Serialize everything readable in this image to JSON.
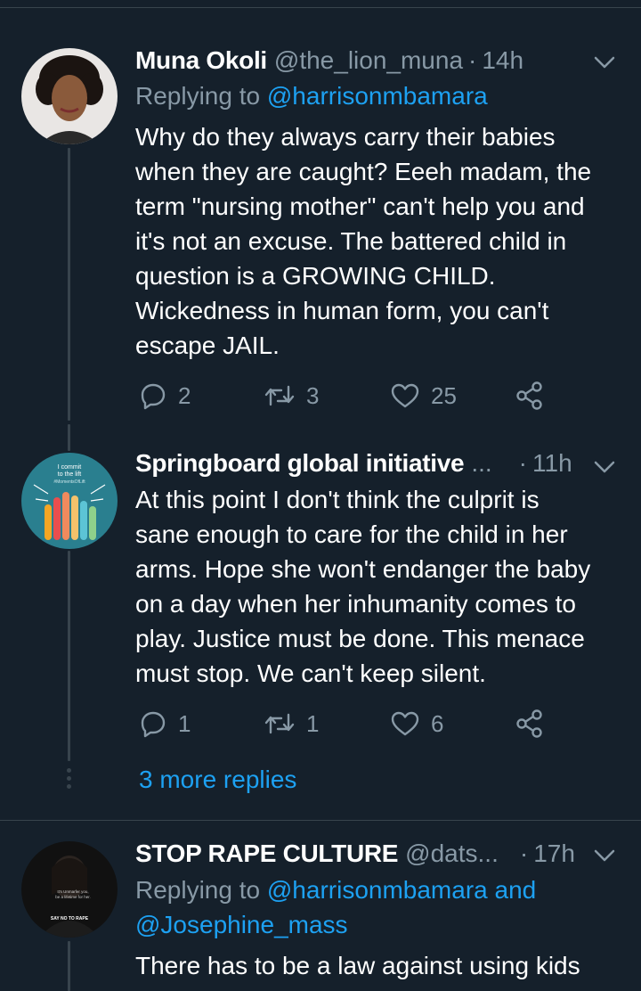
{
  "colors": {
    "background": "#15202b",
    "accent": "#1da1f2",
    "muted": "#8899a6",
    "divider": "#38444d"
  },
  "tweets": [
    {
      "name": "Muna Okoli",
      "handle": "@the_lion_muna",
      "separator": "·",
      "time": "14h",
      "replying_prefix": "Replying to",
      "replying_mentions": [
        "@harrisonmbamara"
      ],
      "text_lines": [
        "Why do they always carry their babies",
        "when they are caught? Eeeh madam, the",
        "term \"nursing mother\" can't help you and",
        "it's not an excuse. The battered child in",
        "question is a GROWING CHILD.",
        "Wickedness in human form, you can't",
        "escape JAIL."
      ],
      "replies": "2",
      "retweets": "3",
      "likes": "25"
    },
    {
      "name": "Springboard global initiative",
      "ellipsis": "...",
      "separator": "·",
      "time": "11h",
      "avatar_text": [
        "I commit",
        "to the lift",
        "#MomentsOfLift"
      ],
      "text_lines": [
        "At this point I don't think the culprit is",
        "sane enough to care for the child in her",
        "arms. Hope she won't endanger the baby",
        "on a day when her inhumanity comes to",
        "play. Justice must be done. This menace",
        "must stop. We can't keep silent."
      ],
      "replies": "1",
      "retweets": "1",
      "likes": "6"
    },
    {
      "name": "STOP RAPE CULTURE",
      "handle": "@dats...",
      "separator": "·",
      "time": "17h",
      "replying_prefix": "Replying to",
      "replying_mentions": [
        "@harrisonmbamara",
        "and",
        "@Josephine_mass"
      ],
      "avatar_text": [
        "It's Unmarfer you,",
        "be a lifetime for her.",
        "SAY NO TO RAPE"
      ],
      "text_lines": [
        "There has to be a law against using kids"
      ]
    }
  ],
  "more_replies": "3 more replies"
}
